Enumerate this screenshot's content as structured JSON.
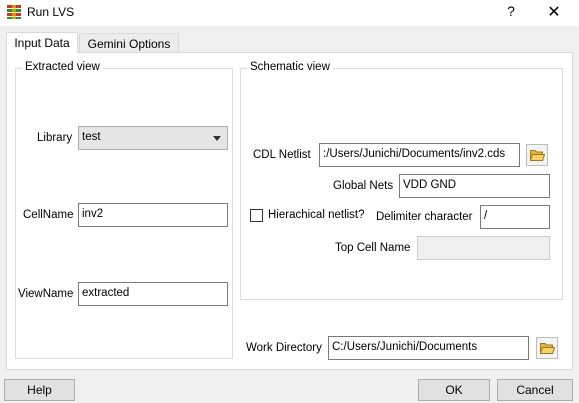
{
  "window": {
    "title": "Run LVS",
    "help_glyph": "?",
    "close_glyph": "✕"
  },
  "tabs": [
    {
      "label": "Input Data",
      "active": true
    },
    {
      "label": "Gemini Options",
      "active": false
    }
  ],
  "extracted_view": {
    "title": "Extracted view",
    "library_label": "Library",
    "library_value": "test",
    "cellname_label": "CellName",
    "cellname_value": "inv2",
    "viewname_label": "ViewName",
    "viewname_value": "extracted"
  },
  "schematic_view": {
    "title": "Schematic view",
    "cdl_netlist_label": "CDL Netlist",
    "cdl_netlist_value": ":/Users/Junichi/Documents/inv2.cds",
    "global_nets_label": "Global Nets",
    "global_nets_value": "VDD GND",
    "hierachical_label": "Hierachical netlist?",
    "hierachical_checked": false,
    "delimiter_label": "Delimiter character",
    "delimiter_value": "/",
    "top_cell_label": "Top Cell Name",
    "top_cell_value": ""
  },
  "work_directory": {
    "label": "Work Directory",
    "value": "C:/Users/Junichi/Documents"
  },
  "buttons": {
    "help": "Help",
    "ok": "OK",
    "cancel": "Cancel"
  },
  "colors": {
    "folder_icon": "#e8b33a",
    "app_icon_red": "#c0392b",
    "app_icon_green": "#2e8b3a"
  }
}
